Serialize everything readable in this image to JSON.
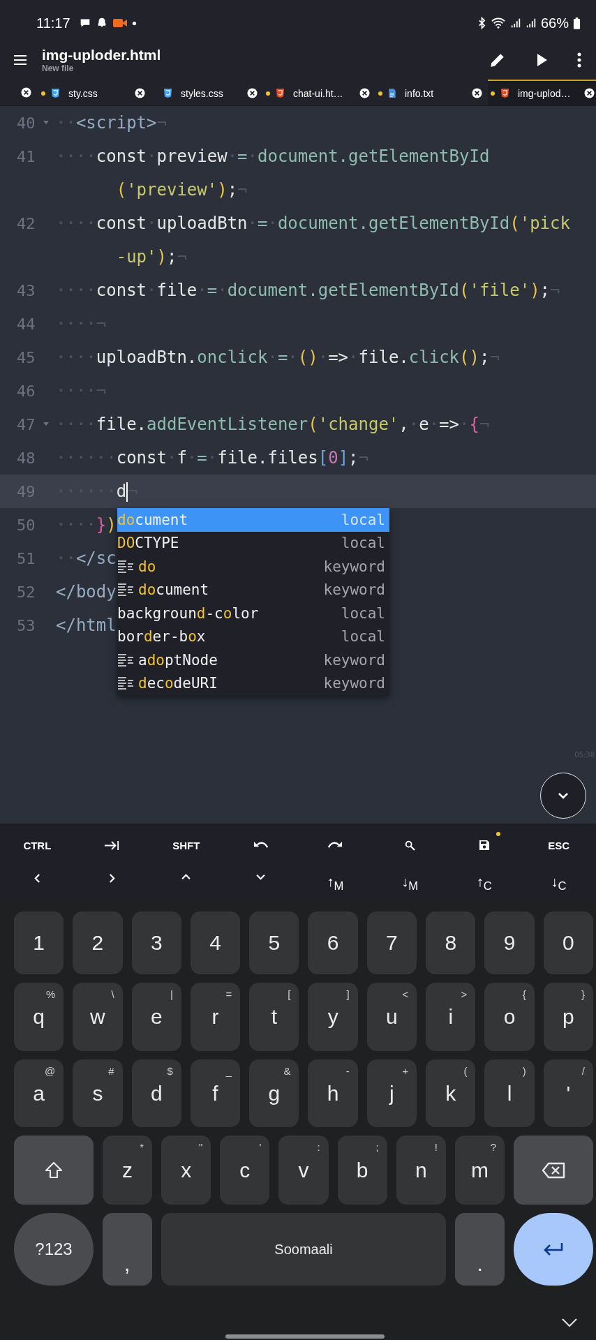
{
  "status_bar": {
    "time": "11:17",
    "battery": "66%"
  },
  "app_bar": {
    "title": "img-uploder.html",
    "subtitle": "New file"
  },
  "tabs": [
    {
      "label": "sty.css",
      "kind": "css",
      "modified": true,
      "selected": false
    },
    {
      "label": "styles.css",
      "kind": "css",
      "modified": false,
      "selected": false
    },
    {
      "label": "chat-ui.ht…",
      "kind": "html",
      "modified": true,
      "selected": false
    },
    {
      "label": "info.txt",
      "kind": "txt",
      "modified": true,
      "selected": false
    },
    {
      "label": "img-uplod…",
      "kind": "html",
      "modified": true,
      "selected": true
    }
  ],
  "editor": {
    "rows": [
      {
        "number": "40",
        "fold": true,
        "current": false,
        "tokens": [
          {
            "kind": "ws",
            "text": "··"
          },
          {
            "kind": "tag",
            "text": "<script>"
          },
          {
            "kind": "ws",
            "text": "¬"
          }
        ]
      },
      {
        "number": "41",
        "fold": false,
        "current": false,
        "tokens": [
          {
            "kind": "ws",
            "text": "····"
          },
          {
            "kind": "plain",
            "text": "const"
          },
          {
            "kind": "ws",
            "text": "·"
          },
          {
            "kind": "plain",
            "text": "preview"
          },
          {
            "kind": "ws",
            "text": "·"
          },
          {
            "kind": "op",
            "text": "="
          },
          {
            "kind": "ws",
            "text": "·"
          },
          {
            "kind": "fn",
            "text": "document.getElementById"
          }
        ]
      },
      {
        "fold": false,
        "current": false,
        "tokens": [
          {
            "kind": "paren",
            "text": "("
          },
          {
            "kind": "str",
            "text": "'preview'"
          },
          {
            "kind": "paren",
            "text": ")"
          },
          {
            "kind": "plain",
            "text": ";"
          },
          {
            "kind": "ws",
            "text": "¬"
          }
        ]
      },
      {
        "number": "42",
        "fold": false,
        "current": false,
        "tokens": [
          {
            "kind": "ws",
            "text": "····"
          },
          {
            "kind": "plain",
            "text": "const"
          },
          {
            "kind": "ws",
            "text": "·"
          },
          {
            "kind": "plain",
            "text": "uploadBtn"
          },
          {
            "kind": "ws",
            "text": "·"
          },
          {
            "kind": "op",
            "text": "="
          },
          {
            "kind": "ws",
            "text": "·"
          },
          {
            "kind": "fn",
            "text": "document.getElementById"
          },
          {
            "kind": "paren",
            "text": "("
          },
          {
            "kind": "str",
            "text": "'pick"
          }
        ]
      },
      {
        "fold": false,
        "current": false,
        "tokens": [
          {
            "kind": "str",
            "text": "-up'"
          },
          {
            "kind": "paren",
            "text": ")"
          },
          {
            "kind": "plain",
            "text": ";"
          },
          {
            "kind": "ws",
            "text": "¬"
          }
        ]
      },
      {
        "number": "43",
        "fold": false,
        "current": false,
        "tokens": [
          {
            "kind": "ws",
            "text": "····"
          },
          {
            "kind": "plain",
            "text": "const"
          },
          {
            "kind": "ws",
            "text": "·"
          },
          {
            "kind": "plain",
            "text": "file"
          },
          {
            "kind": "ws",
            "text": "·"
          },
          {
            "kind": "op",
            "text": "="
          },
          {
            "kind": "ws",
            "text": "·"
          },
          {
            "kind": "fn",
            "text": "document.getElementById"
          },
          {
            "kind": "paren",
            "text": "("
          },
          {
            "kind": "str",
            "text": "'file'"
          },
          {
            "kind": "paren",
            "text": ")"
          },
          {
            "kind": "plain",
            "text": ";"
          },
          {
            "kind": "ws",
            "text": "¬"
          }
        ]
      },
      {
        "number": "44",
        "fold": false,
        "current": false,
        "tokens": [
          {
            "kind": "ws",
            "text": "····¬"
          }
        ]
      },
      {
        "number": "45",
        "fold": false,
        "current": false,
        "tokens": [
          {
            "kind": "ws",
            "text": "····"
          },
          {
            "kind": "plain",
            "text": "uploadBtn."
          },
          {
            "kind": "fn",
            "text": "onclick"
          },
          {
            "kind": "ws",
            "text": "·"
          },
          {
            "kind": "op",
            "text": "="
          },
          {
            "kind": "ws",
            "text": "·"
          },
          {
            "kind": "paren",
            "text": "()"
          },
          {
            "kind": "ws",
            "text": "·"
          },
          {
            "kind": "plain",
            "text": "=>"
          },
          {
            "kind": "ws",
            "text": "·"
          },
          {
            "kind": "plain",
            "text": "file."
          },
          {
            "kind": "fn",
            "text": "click"
          },
          {
            "kind": "paren",
            "text": "()"
          },
          {
            "kind": "plain",
            "text": ";"
          },
          {
            "kind": "ws",
            "text": "¬"
          }
        ]
      },
      {
        "number": "46",
        "fold": false,
        "current": false,
        "tokens": [
          {
            "kind": "ws",
            "text": "····¬"
          }
        ]
      },
      {
        "number": "47",
        "fold": true,
        "current": false,
        "tokens": [
          {
            "kind": "ws",
            "text": "····"
          },
          {
            "kind": "plain",
            "text": "file."
          },
          {
            "kind": "fn",
            "text": "addEventListener"
          },
          {
            "kind": "paren",
            "text": "("
          },
          {
            "kind": "str",
            "text": "'change'"
          },
          {
            "kind": "plain",
            "text": ","
          },
          {
            "kind": "ws",
            "text": "·"
          },
          {
            "kind": "plain",
            "text": "e"
          },
          {
            "kind": "ws",
            "text": "·"
          },
          {
            "kind": "plain",
            "text": "=>"
          },
          {
            "kind": "ws",
            "text": "·"
          },
          {
            "kind": "brace",
            "text": "{"
          },
          {
            "kind": "ws",
            "text": "¬"
          }
        ]
      },
      {
        "number": "48",
        "fold": false,
        "current": false,
        "tokens": [
          {
            "kind": "ws",
            "text": "······"
          },
          {
            "kind": "plain",
            "text": "const"
          },
          {
            "kind": "ws",
            "text": "·"
          },
          {
            "kind": "plain",
            "text": "f"
          },
          {
            "kind": "ws",
            "text": "·"
          },
          {
            "kind": "op",
            "text": "="
          },
          {
            "kind": "ws",
            "text": "·"
          },
          {
            "kind": "plain",
            "text": "file.files"
          },
          {
            "kind": "bracket",
            "text": "["
          },
          {
            "kind": "num",
            "text": "0"
          },
          {
            "kind": "bracket",
            "text": "]"
          },
          {
            "kind": "plain",
            "text": ";"
          },
          {
            "kind": "ws",
            "text": "¬"
          }
        ]
      },
      {
        "number": "49",
        "fold": false,
        "current": true,
        "tokens": [
          {
            "kind": "ws",
            "text": "······"
          },
          {
            "kind": "plain",
            "text": "d",
            "cursor": true
          },
          {
            "kind": "ws",
            "text": "¬"
          }
        ]
      },
      {
        "number": "50",
        "fold": false,
        "current": false,
        "tokens": [
          {
            "kind": "ws",
            "text": "····"
          },
          {
            "kind": "brace",
            "text": "}"
          },
          {
            "kind": "paren",
            "text": ")"
          }
        ]
      },
      {
        "number": "51",
        "fold": false,
        "current": false,
        "tokens": [
          {
            "kind": "ws",
            "text": "··"
          },
          {
            "kind": "tag",
            "text": "</sc"
          }
        ]
      },
      {
        "number": "52",
        "fold": false,
        "current": false,
        "tokens": [
          {
            "kind": "tag",
            "text": "</body"
          }
        ]
      },
      {
        "number": "53",
        "fold": false,
        "current": false,
        "tokens": [
          {
            "kind": "tag",
            "text": "</html"
          }
        ]
      }
    ],
    "scroll_label": "05:38"
  },
  "suggestions": [
    {
      "parts": [
        {
          "text": "do",
          "match": true
        },
        {
          "text": "cument",
          "match": false
        }
      ],
      "type": "local",
      "icon": false,
      "selected": true
    },
    {
      "parts": [
        {
          "text": "DO",
          "match": true
        },
        {
          "text": "CTYPE",
          "match": false
        }
      ],
      "type": "local",
      "icon": false,
      "selected": false
    },
    {
      "parts": [
        {
          "text": "do",
          "match": true
        }
      ],
      "type": "keyword",
      "icon": true,
      "selected": false
    },
    {
      "parts": [
        {
          "text": "do",
          "match": true
        },
        {
          "text": "cument",
          "match": false
        }
      ],
      "type": "keyword",
      "icon": true,
      "selected": false
    },
    {
      "parts": [
        {
          "text": "backgroun",
          "match": false
        },
        {
          "text": "d",
          "match": true
        },
        {
          "text": "-c",
          "match": false
        },
        {
          "text": "o",
          "match": true
        },
        {
          "text": "lor",
          "match": false
        }
      ],
      "type": "local",
      "icon": false,
      "selected": false
    },
    {
      "parts": [
        {
          "text": "bor",
          "match": false
        },
        {
          "text": "d",
          "match": true
        },
        {
          "text": "er-b",
          "match": false
        },
        {
          "text": "o",
          "match": true
        },
        {
          "text": "x",
          "match": false
        }
      ],
      "type": "local",
      "icon": false,
      "selected": false
    },
    {
      "parts": [
        {
          "text": "a",
          "match": false
        },
        {
          "text": "do",
          "match": true
        },
        {
          "text": "ptNode",
          "match": false
        }
      ],
      "type": "keyword",
      "icon": true,
      "selected": false
    },
    {
      "parts": [
        {
          "text": "d",
          "match": true
        },
        {
          "text": "ec",
          "match": false
        },
        {
          "text": "o",
          "match": true
        },
        {
          "text": "deURI",
          "match": false
        }
      ],
      "type": "keyword",
      "icon": true,
      "selected": false
    }
  ],
  "toolbar": {
    "rows": [
      [
        {
          "kind": "text",
          "label": "CTRL",
          "badge": false
        },
        {
          "kind": "icon",
          "badge": false
        },
        {
          "kind": "text",
          "label": "SHFT",
          "badge": false
        },
        {
          "kind": "icon",
          "badge": false
        },
        {
          "kind": "icon",
          "badge": false
        },
        {
          "kind": "icon",
          "badge": false
        },
        {
          "kind": "icon",
          "badge": true
        },
        {
          "kind": "text",
          "label": "ESC",
          "badge": false
        }
      ],
      [
        {
          "kind": "icon",
          "badge": false
        },
        {
          "kind": "icon",
          "badge": false
        },
        {
          "kind": "icon",
          "badge": false
        },
        {
          "kind": "icon",
          "badge": false
        },
        {
          "kind": "text",
          "label": "↑$_{M}$",
          "badge": false
        },
        {
          "kind": "text",
          "label": "↓$_{M}$",
          "badge": false
        },
        {
          "kind": "text",
          "label": "↑$_{C}$",
          "badge": false
        },
        {
          "kind": "text",
          "label": "↓$_{C}$",
          "badge": false
        }
      ]
    ]
  },
  "keyboard": {
    "key_rows": [
      {
        "kind": "plain",
        "keys": [
          {
            "label": "1"
          },
          {
            "label": "2"
          },
          {
            "label": "3"
          },
          {
            "label": "4"
          },
          {
            "label": "5"
          },
          {
            "label": "6"
          },
          {
            "label": "7"
          },
          {
            "label": "8"
          },
          {
            "label": "9"
          },
          {
            "label": "0"
          }
        ]
      },
      {
        "kind": "plain",
        "keys": [
          {
            "label": "q",
            "hint": "%"
          },
          {
            "label": "w",
            "hint": "\\"
          },
          {
            "label": "e",
            "hint": "|"
          },
          {
            "label": "r",
            "hint": "="
          },
          {
            "label": "t",
            "hint": "["
          },
          {
            "label": "y",
            "hint": "]"
          },
          {
            "label": "u",
            "hint": "<"
          },
          {
            "label": "i",
            "hint": ">"
          },
          {
            "label": "o",
            "hint": "{"
          },
          {
            "label": "p",
            "hint": "}"
          }
        ]
      },
      {
        "kind": "plain",
        "keys": [
          {
            "label": "a",
            "hint": "@"
          },
          {
            "label": "s",
            "hint": "#"
          },
          {
            "label": "d",
            "hint": "$"
          },
          {
            "label": "f",
            "hint": "_"
          },
          {
            "label": "g",
            "hint": "&"
          },
          {
            "label": "h",
            "hint": "-"
          },
          {
            "label": "j",
            "hint": "+"
          },
          {
            "label": "k",
            "hint": "("
          },
          {
            "label": "l",
            "hint": ")"
          },
          {
            "label": "'",
            "hint": "/"
          }
        ]
      },
      {
        "kind": "shift",
        "keys": [
          {
            "label": "z",
            "hint": "*"
          },
          {
            "label": "x",
            "hint": "\""
          },
          {
            "label": "c",
            "hint": "'"
          },
          {
            "label": "v",
            "hint": ":"
          },
          {
            "label": "b",
            "hint": ";"
          },
          {
            "label": "n",
            "hint": "!"
          },
          {
            "label": "m",
            "hint": "?"
          }
        ]
      }
    ],
    "bottom_row": {
      "mode": "?123",
      "comma": ",",
      "space": "Soomaali",
      "period": "."
    }
  }
}
